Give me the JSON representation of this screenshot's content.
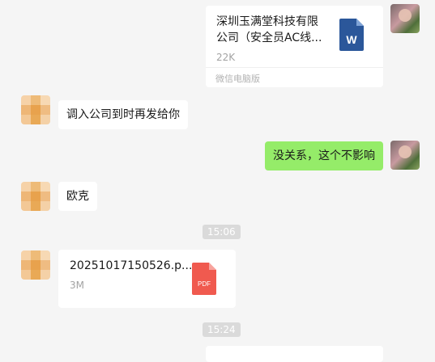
{
  "messages": {
    "file_word": {
      "name_line1": "深圳玉满堂科技有限",
      "name_line2": "公司（安全员AC线...",
      "size": "22K",
      "source": "微信电脑版",
      "icon": "word-file-icon",
      "icon_letter": "W"
    },
    "msg1": "调入公司到时再发给你",
    "msg2": "没关系，这个不影响",
    "msg3": "欧克",
    "time1": "15:06",
    "file_pdf": {
      "name": "20251017150526.p...",
      "size": "3M",
      "icon": "pdf-file-icon",
      "icon_label": "PDF"
    },
    "time2": "15:24"
  },
  "colors": {
    "background": "#f5f5f5",
    "self_bubble": "#95ec69",
    "other_bubble": "#ffffff",
    "word_blue": "#2b579a",
    "pdf_red": "#f05a4f"
  }
}
